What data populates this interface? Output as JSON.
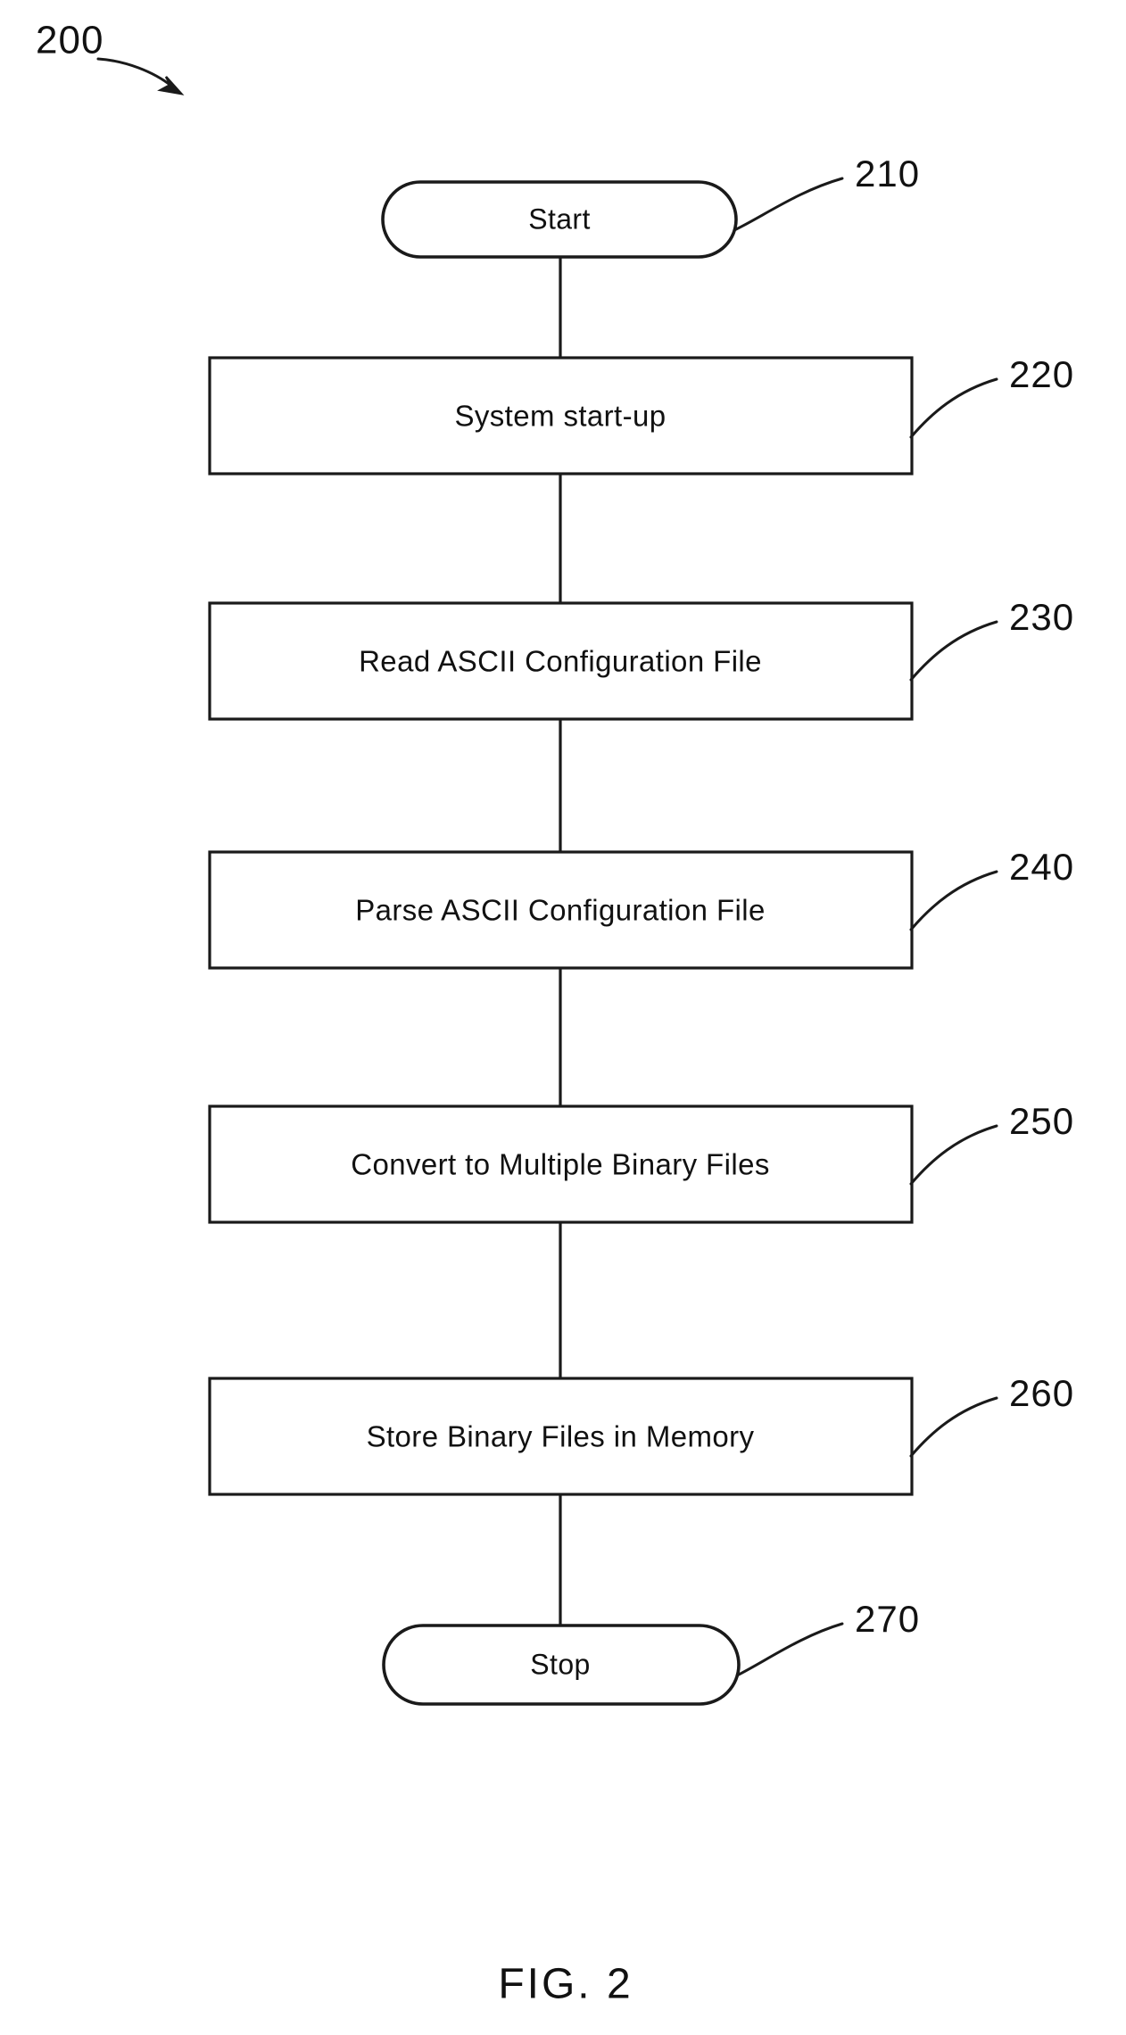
{
  "figure": {
    "caption": "FIG. 2",
    "sheet_reference": "200",
    "type": "flowchart",
    "background_color": "#ffffff",
    "line_color": "#1a1a1a"
  },
  "flow": {
    "nodes": [
      {
        "id": "start",
        "label": "Start",
        "shape": "stadium",
        "reference_numeral": "210"
      },
      {
        "id": "system-start-up",
        "label": "System start-up",
        "shape": "rectangle",
        "reference_numeral": "220"
      },
      {
        "id": "read-ascii-configuration-file",
        "label": "Read ASCII Configuration File",
        "shape": "rectangle",
        "reference_numeral": "230"
      },
      {
        "id": "parse-ascii-configuration-file",
        "label": "Parse ASCII Configuration File",
        "shape": "rectangle",
        "reference_numeral": "240"
      },
      {
        "id": "convert-to-multiple-binary-files",
        "label": "Convert to Multiple Binary Files",
        "shape": "rectangle",
        "reference_numeral": "250"
      },
      {
        "id": "store-binary-files-in-memory",
        "label": "Store Binary Files in Memory",
        "shape": "rectangle",
        "reference_numeral": "260"
      },
      {
        "id": "stop",
        "label": "Stop",
        "shape": "stadium",
        "reference_numeral": "270"
      }
    ],
    "edges": [
      {
        "from": "start",
        "to": "system-start-up"
      },
      {
        "from": "system-start-up",
        "to": "read-ascii-configuration-file"
      },
      {
        "from": "read-ascii-configuration-file",
        "to": "parse-ascii-configuration-file"
      },
      {
        "from": "parse-ascii-configuration-file",
        "to": "convert-to-multiple-binary-files"
      },
      {
        "from": "convert-to-multiple-binary-files",
        "to": "store-binary-files-in-memory"
      },
      {
        "from": "store-binary-files-in-memory",
        "to": "stop"
      }
    ]
  }
}
